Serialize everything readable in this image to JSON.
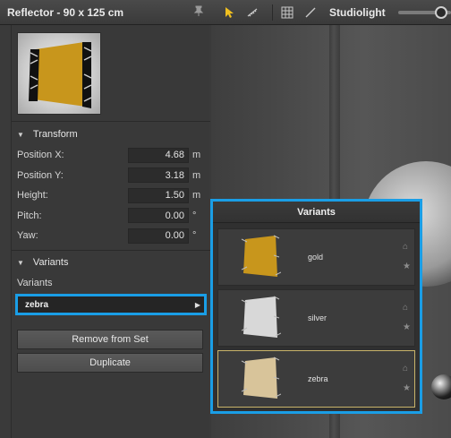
{
  "header": {
    "title": "Reflector - 90 x 125 cm",
    "studiolight_label": "Studiolight",
    "studiolight_level": 0.9
  },
  "transform": {
    "section_label": "Transform",
    "rows": [
      {
        "label": "Position X:",
        "value": "4.68",
        "unit": "m"
      },
      {
        "label": "Position Y:",
        "value": "3.18",
        "unit": "m"
      },
      {
        "label": "Height:",
        "value": "1.50",
        "unit": "m"
      },
      {
        "label": "Pitch:",
        "value": "0.00",
        "unit": "°"
      },
      {
        "label": "Yaw:",
        "value": "0.00",
        "unit": "°"
      }
    ]
  },
  "variants_section": {
    "section_label": "Variants",
    "field_label": "Variants",
    "selected_value": "zebra"
  },
  "actions": {
    "remove_label": "Remove from Set",
    "duplicate_label": "Duplicate"
  },
  "variants_popup": {
    "title": "Variants",
    "items": [
      {
        "name": "gold",
        "color": "#c8961c"
      },
      {
        "name": "silver",
        "color": "#d8d8d8"
      },
      {
        "name": "zebra",
        "color": "#d8c49a"
      }
    ],
    "selected_index": 2
  },
  "colors": {
    "accent": "#1a9ee6",
    "active_tool": "#f0c020",
    "panel_bg": "#3a3a3a"
  }
}
